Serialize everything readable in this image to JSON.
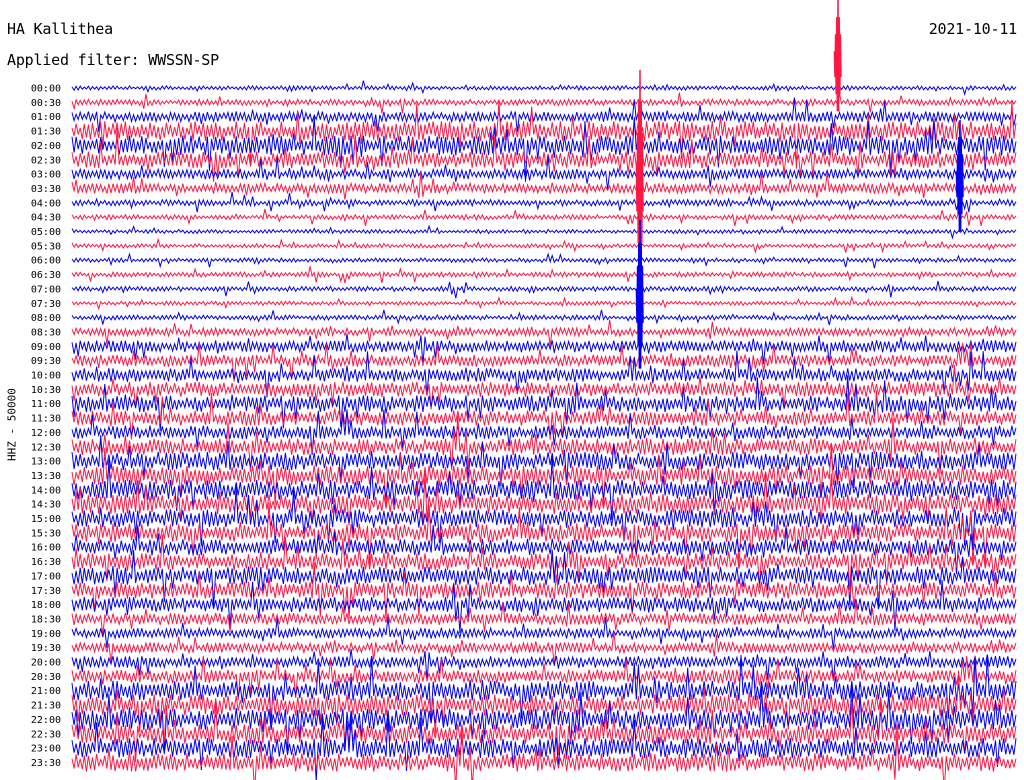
{
  "header": {
    "station": "HA Kallithea",
    "filter": "Applied filter: WWSSN-SP",
    "date": "2021-10-11"
  },
  "chart_data": {
    "type": "line",
    "title": "HA Kallithea",
    "subtitle": "Applied filter: WWSSN-SP",
    "date": "2021-10-11",
    "ylabel": "HHZ - 50000",
    "grid": false,
    "trace_colors": [
      "#0000ee",
      "#ff1744"
    ],
    "categories": [
      "00:00",
      "00:30",
      "01:00",
      "01:30",
      "02:00",
      "02:30",
      "03:00",
      "03:30",
      "04:00",
      "04:30",
      "05:00",
      "05:30",
      "06:00",
      "06:30",
      "07:00",
      "07:30",
      "08:00",
      "08:30",
      "09:00",
      "09:30",
      "10:00",
      "10:30",
      "11:00",
      "11:30",
      "12:00",
      "12:30",
      "13:00",
      "13:30",
      "14:00",
      "14:30",
      "15:00",
      "15:30",
      "16:00",
      "16:30",
      "17:00",
      "17:30",
      "18:00",
      "18:30",
      "19:00",
      "19:30",
      "20:00",
      "20:30",
      "21:00",
      "21:30",
      "22:00",
      "22:30",
      "23:00",
      "23:30"
    ],
    "activity_level": [
      0.06,
      0.12,
      0.25,
      0.55,
      0.55,
      0.45,
      0.25,
      0.25,
      0.12,
      0.08,
      0.05,
      0.05,
      0.06,
      0.08,
      0.08,
      0.05,
      0.08,
      0.18,
      0.3,
      0.3,
      0.35,
      0.4,
      0.45,
      0.4,
      0.35,
      0.45,
      0.5,
      0.55,
      0.55,
      0.55,
      0.5,
      0.5,
      0.45,
      0.45,
      0.5,
      0.45,
      0.4,
      0.3,
      0.25,
      0.25,
      0.3,
      0.35,
      0.55,
      0.6,
      0.6,
      0.55,
      0.55,
      0.5
    ]
  }
}
